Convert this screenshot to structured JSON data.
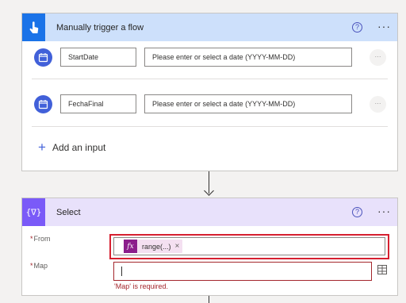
{
  "trigger": {
    "title": "Manually trigger a flow",
    "help_glyph": "?",
    "more_glyph": "···",
    "inputs": [
      {
        "name": "StartDate",
        "placeholder": "Please enter or select a date (YYYY-MM-DD)",
        "more_glyph": "···"
      },
      {
        "name": "FechaFinal",
        "placeholder": "Please enter or select a date (YYYY-MM-DD)",
        "more_glyph": "···"
      }
    ],
    "add_input_label": "Add an input",
    "add_input_glyph": "+"
  },
  "select_action": {
    "title": "Select",
    "icon_glyph": "{∇}",
    "help_glyph": "?",
    "more_glyph": "···",
    "from": {
      "label": "From",
      "required_mark": "*",
      "token": {
        "fx_glyph": "fx",
        "text": "range(...)",
        "remove_glyph": "×"
      }
    },
    "map": {
      "label": "Map",
      "required_mark": "*",
      "value": "",
      "error": "'Map' is required."
    }
  },
  "colors": {
    "trigger_header": "#cde0fb",
    "trigger_icon": "#1a73e8",
    "select_header": "#e8e1fb",
    "select_icon": "#7a5af8",
    "highlight_outline": "#d62030",
    "error_text": "#a4262c",
    "expression_token": "#8b1e8b"
  }
}
